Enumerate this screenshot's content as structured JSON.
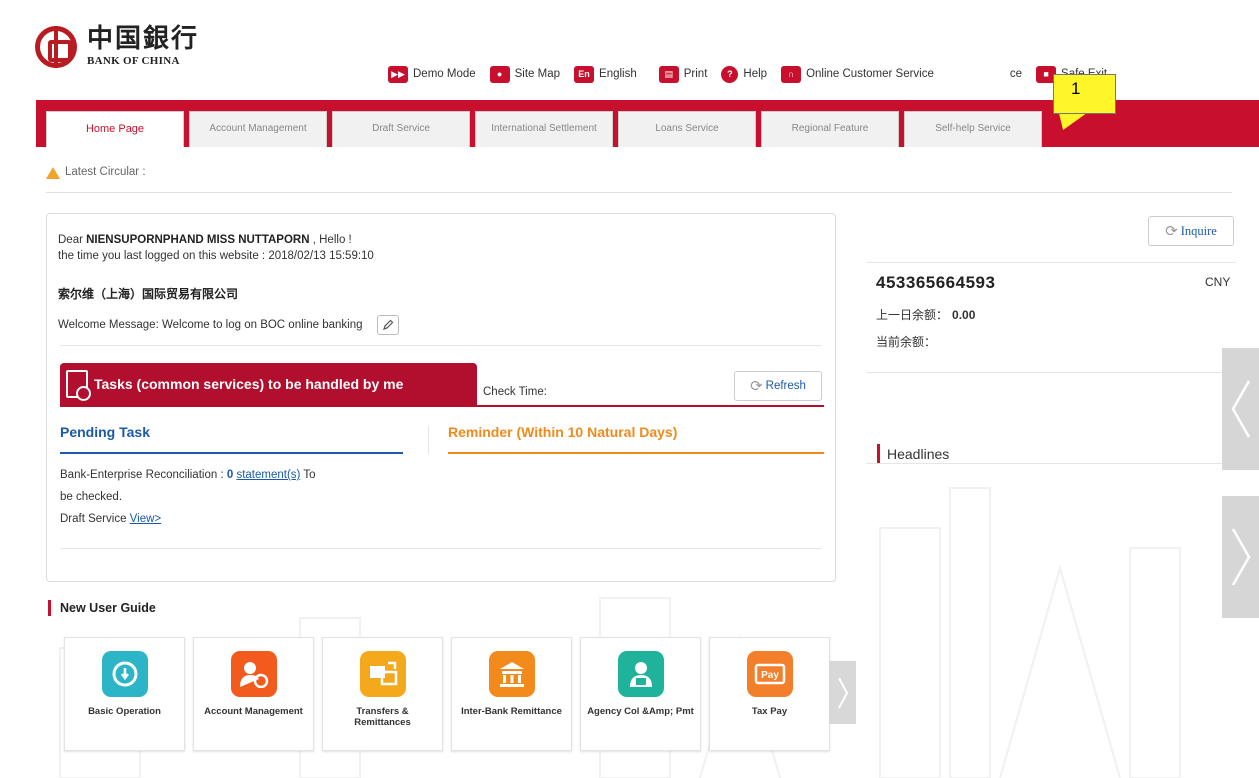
{
  "brand": {
    "name_cn": "中国銀行",
    "name_en": "BANK OF CHINA"
  },
  "topbar": [
    {
      "label": "Demo Mode",
      "icon": "demo-icon"
    },
    {
      "label": "Site Map",
      "icon": "location-pin-icon"
    },
    {
      "label": "English",
      "icon": "language-icon"
    },
    {
      "label": "Print",
      "icon": "printer-icon"
    },
    {
      "label": "Help",
      "icon": "help-icon"
    },
    {
      "label": "Online Customer Service",
      "icon": "headset-icon"
    },
    {
      "label": "ce",
      "icon": "notice-icon"
    },
    {
      "label": "Safe Exit",
      "icon": "lock-icon"
    }
  ],
  "nav": {
    "tabs": [
      {
        "label": "Home Page",
        "active": true
      },
      {
        "label": "Account Management"
      },
      {
        "label": "Draft Service"
      },
      {
        "label": "International Settlement"
      },
      {
        "label": "Loans Service"
      },
      {
        "label": "Regional Feature"
      },
      {
        "label": "Self-help Service"
      }
    ]
  },
  "callout": {
    "label": "1"
  },
  "circular": {
    "label": "Latest Circular :"
  },
  "welcome": {
    "greeting_prefix": "Dear ",
    "user_name": "NIENSUPORNPHAND MISS NUTTAPORN",
    "greeting_suffix": " , Hello !",
    "last_login": "the time you last logged on this website : 2018/02/13 15:59:10",
    "company": "索尔维（上海）国际贸易有限公司",
    "message": "Welcome Message: Welcome to log on BOC online banking"
  },
  "tasks": {
    "title": "Tasks (common services) to be handled by me",
    "check_time": "Check Time:",
    "refresh_label": "Refresh",
    "pending_tab": "Pending Task",
    "reminder_tab": "Reminder (Within 10 Natural Days)",
    "recon_prefix": "Bank-Enterprise Reconciliation : ",
    "recon_count": "0",
    "recon_link": "statement(s)",
    "recon_suffix": " To",
    "recon_line2": "be checked.",
    "draft_prefix": "Draft Service ",
    "draft_link": "View>"
  },
  "account": {
    "inquire_label": "Inquire",
    "number": "453365664593",
    "currency": "CNY",
    "prev_balance_label": "上一日余额：",
    "prev_balance_value": "0.00",
    "current_balance_label": "当前余额：",
    "headlines": "Headlines"
  },
  "guide": {
    "title": "New User Guide",
    "tiles": [
      {
        "label": "Basic Operation",
        "icon": "basic-operation-icon",
        "color": "#2cb5c7"
      },
      {
        "label": "Account Management",
        "icon": "account-management-icon",
        "color": "#f25a1e"
      },
      {
        "label": "Transfers & Remittances",
        "icon": "transfers-icon",
        "color": "#f4a81c"
      },
      {
        "label": "Inter-Bank Remittance",
        "icon": "bank-building-icon",
        "color": "#f28a1c"
      },
      {
        "label": "Agency Col &Amp; Pmt",
        "icon": "agency-icon",
        "color": "#1fb39c"
      },
      {
        "label": "Tax Pay",
        "icon": "tax-pay-icon",
        "color": "#f47f2a"
      }
    ]
  },
  "colors": {
    "brand_red": "#c8102e",
    "link_blue": "#1a5aa8",
    "reminder_orange": "#f08a1c"
  }
}
